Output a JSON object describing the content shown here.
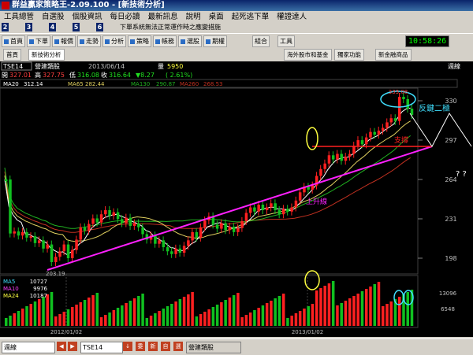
{
  "window": {
    "title": "群益贏家策略王-2.09.100 - [新技術分析]"
  },
  "menu": {
    "items": [
      "工具總管",
      "自選股",
      "個股資訊",
      "每日必讀",
      "最新訊息",
      "說明",
      "桌面",
      "起死逃下單",
      "權證達人"
    ]
  },
  "submenu": {
    "tabs": [
      "2",
      "3",
      "4",
      "5",
      "6"
    ],
    "notice": "下單系統無法正常運作時之應變措施"
  },
  "toolbar": {
    "buttons": [
      "首頁",
      "下單",
      "報價",
      "走勢",
      "分析",
      "策略",
      "帳務",
      "選股",
      "期權"
    ],
    "right_buttons": [
      "組合",
      "工具"
    ],
    "clock": "10:58:26"
  },
  "toolbar2": {
    "tab1": "首頁",
    "tab2": "新技術分析",
    "buttons": [
      "海外股市和基金",
      "獨家功能",
      "新金融商品"
    ]
  },
  "chart_header": {
    "symbol": "TSE14",
    "name": "營建類股",
    "date": "2013/06/14",
    "volume_label": "量",
    "volume": "5950",
    "open_label": "開",
    "open": "327.01",
    "high_label": "高",
    "high": "327.75",
    "low_label": "低",
    "low": "316.08",
    "close_label": "收",
    "close": "316.64",
    "change": "▼8.27",
    "change_pct": "( 2.61%)",
    "period": "週線"
  },
  "ma_legend": {
    "ma20_label": "MA20",
    "ma20": "312.14",
    "ma65_label": "MA65",
    "ma65": "282.44",
    "ma130_label": "MA130",
    "ma130": "290.87",
    "ma260_label": "MA260",
    "ma260": "268.53"
  },
  "vol_legend": {
    "ma5_label": "MA5",
    "ma5": "10727",
    "ma10_label": "MA10",
    "ma10": "9976",
    "ma24_label": "MA24",
    "ma24": "10187"
  },
  "annotations": {
    "key_level": "反鍵二極",
    "support": "支撐",
    "uptrend": "上升線",
    "question": "? ?",
    "peak_label": "333.08",
    "low_label": "203.19"
  },
  "axes": {
    "price_ticks": [
      "330",
      "297",
      "264",
      "231",
      "198"
    ],
    "vol_ticks": [
      "13096",
      "6548"
    ],
    "date_ticks": [
      "2012/01/02",
      "2013/01/02"
    ]
  },
  "statusbar": {
    "period": "週線",
    "symbol": "TSE14",
    "name": "營建類股"
  },
  "colors": {
    "up": "#ff2020",
    "down": "#10c020",
    "ma20": "#ffffff",
    "ma65": "#e0d060",
    "ma130": "#20b020",
    "ma260": "#c03020",
    "trend": "#ff20ff",
    "annotation": "#40e0ff"
  }
}
